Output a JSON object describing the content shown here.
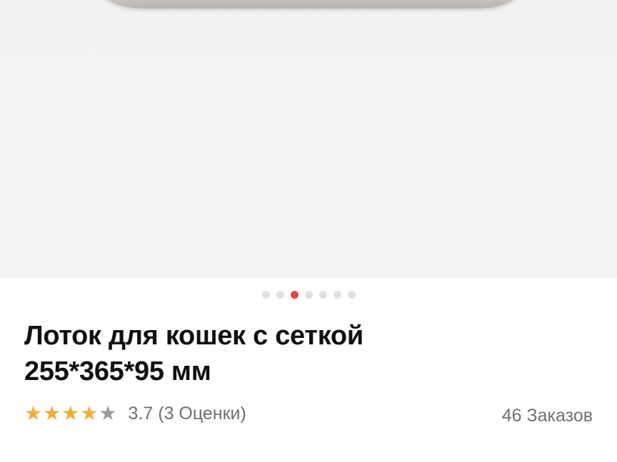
{
  "product": {
    "image_alt": "Лоток для кошек",
    "carousel": {
      "total": 7,
      "active_index": 2
    },
    "title_line1": "Лоток для кошек с сеткой",
    "title_line2": "255*365*95 мм",
    "rating": {
      "value": 3.7,
      "stars_full": 4,
      "stars_max": 5,
      "text": "3.7 (3 Оценки)"
    },
    "orders_text": "46 Заказов"
  },
  "colors": {
    "accent_dot": "#e8473c",
    "star": "#f0ad3b",
    "star_empty": "#9a9a9a",
    "muted_text": "#707070"
  },
  "icons": {
    "star": "star-icon"
  }
}
